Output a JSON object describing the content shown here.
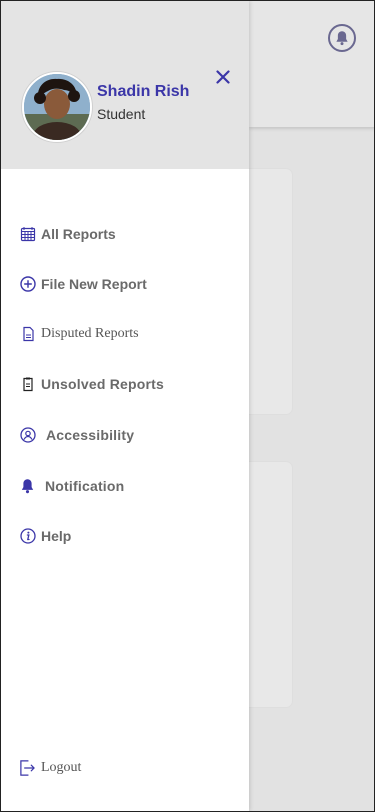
{
  "drawer": {
    "user": {
      "name": "Shadin Rish",
      "role": "Student"
    },
    "menu": [
      {
        "label": "All Reports",
        "icon": "calendar-grid-icon"
      },
      {
        "label": "File New Report",
        "icon": "plus-circle-icon"
      },
      {
        "label": "Disputed Reports",
        "icon": "document-icon"
      },
      {
        "label": "Unsolved Reports",
        "icon": "clipboard-icon"
      },
      {
        "label": "Accessibility",
        "icon": "user-circle-icon"
      },
      {
        "label": "Notification",
        "icon": "bell-icon"
      },
      {
        "label": "Help",
        "icon": "info-circle-icon"
      }
    ],
    "logout_label": "Logout"
  },
  "colors": {
    "accent": "#3b36a8",
    "drawer_header": "#e4e4e4",
    "background": "#e2e2e2"
  }
}
